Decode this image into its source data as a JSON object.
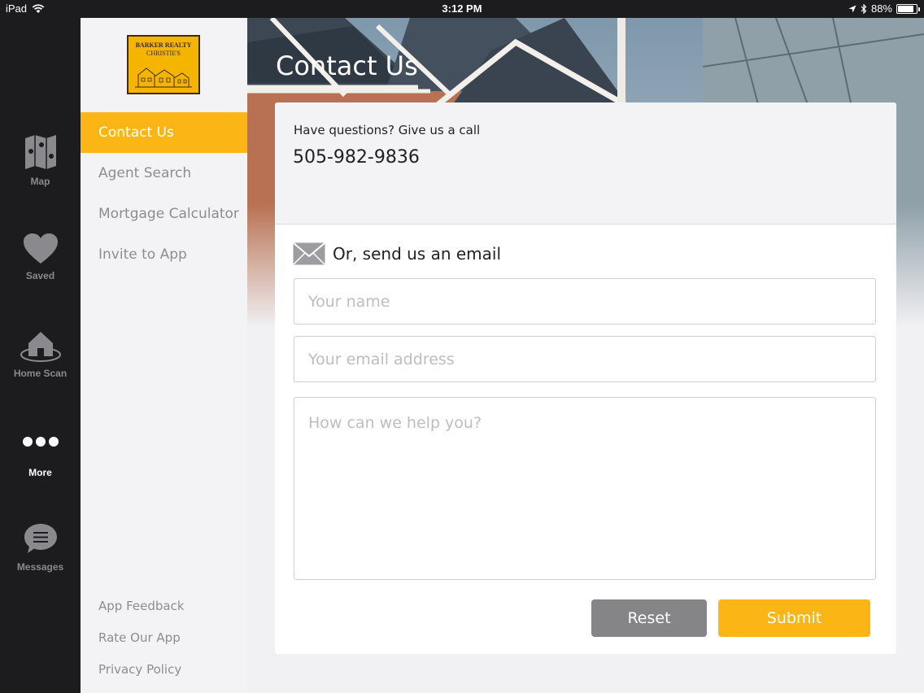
{
  "status_bar": {
    "device": "iPad",
    "time": "3:12 PM",
    "battery": "88%",
    "battery_level": 0.88
  },
  "tabbar": {
    "items": [
      {
        "label": "Map",
        "icon": "map-icon",
        "active": false
      },
      {
        "label": "Saved",
        "icon": "heart-icon",
        "active": false
      },
      {
        "label": "Home Scan",
        "icon": "home-scan-icon",
        "active": false
      },
      {
        "label": "More",
        "icon": "more-dots-icon",
        "active": true
      },
      {
        "label": "Messages",
        "icon": "chat-bubble-icon",
        "active": false
      }
    ]
  },
  "logo": {
    "line1": "BARKER REALTY",
    "line2": "CHRISTIE'S"
  },
  "sidemenu": {
    "items": [
      {
        "label": "Contact Us",
        "active": true
      },
      {
        "label": "Agent Search",
        "active": false
      },
      {
        "label": "Mortgage Calculator",
        "active": false
      },
      {
        "label": "Invite to App",
        "active": false
      }
    ],
    "footer": [
      {
        "label": "App Feedback"
      },
      {
        "label": "Rate Our App"
      },
      {
        "label": "Privacy Policy"
      }
    ]
  },
  "main": {
    "title": "Contact Us",
    "call_label": "Have questions? Give us a call",
    "phone": "505-982-9836",
    "email_heading": "Or, send us an email",
    "name_placeholder": "Your name",
    "email_placeholder": "Your email address",
    "message_placeholder": "How can we help you?",
    "reset_label": "Reset",
    "submit_label": "Submit"
  },
  "colors": {
    "accent": "#fbb616",
    "reset_button": "#858588",
    "tabbar_bg": "#1c1c1e",
    "sidemenu_bg": "#f3f2f4"
  }
}
